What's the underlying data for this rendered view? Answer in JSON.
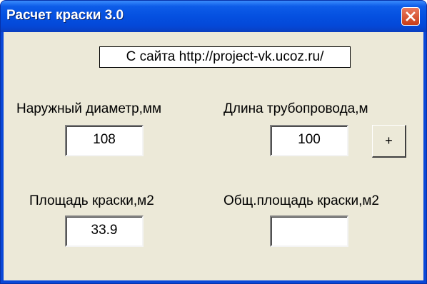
{
  "window": {
    "title": "Расчет краски 3.0"
  },
  "header": {
    "site_label": "С сайта http://project-vk.ucoz.ru/"
  },
  "form": {
    "outer_diameter": {
      "label": "Наружный диаметр,мм",
      "value": "108"
    },
    "pipeline_length": {
      "label": "Длина трубопровода,м",
      "value": "100"
    },
    "paint_area": {
      "label": "Площадь краски,м2",
      "value": "33.9"
    },
    "total_paint_area": {
      "label": "Общ.площадь краски,м2",
      "value": ""
    },
    "add_button_label": "+"
  },
  "icons": {
    "close": "close-icon"
  },
  "colors": {
    "titlebar": "#0550e0",
    "close_button": "#d9542f",
    "client_background": "#ece9d8"
  }
}
